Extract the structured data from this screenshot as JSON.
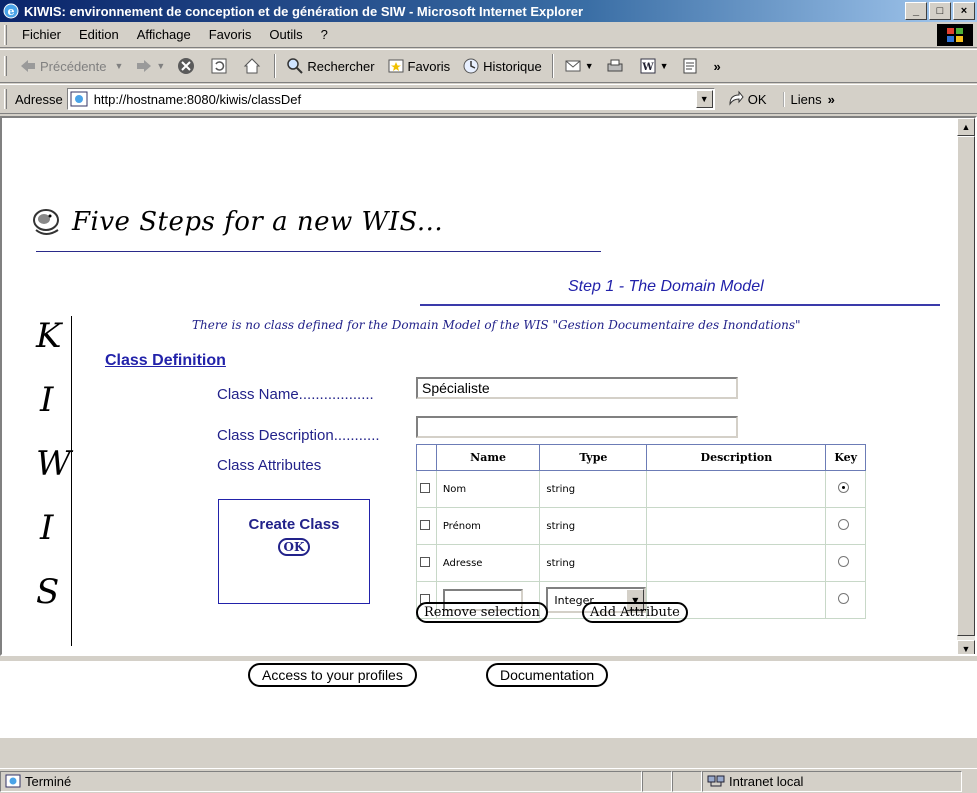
{
  "window": {
    "title": "KIWIS: environnement de conception et de génération de SIW - Microsoft Internet Explorer",
    "controls": [
      "_",
      "□",
      "×"
    ]
  },
  "menu": {
    "items": [
      "Fichier",
      "Edition",
      "Affichage",
      "Favoris",
      "Outils",
      "?"
    ]
  },
  "toolbar": {
    "back": "Précédente",
    "search": "Rechercher",
    "favorites": "Favoris",
    "history": "Historique"
  },
  "address": {
    "label": "Adresse",
    "url": "http://hostname:8080/kiwis/classDef",
    "go": "OK",
    "links": "Liens"
  },
  "page": {
    "headline": "Five Steps for a new WIS...",
    "step_title": "Step 1 - The Domain Model",
    "notice": "There is no class defined for the Domain Model of the WIS \"Gestion Documentaire des Inondations\"",
    "kiwis_letters": [
      "K",
      "I",
      "W",
      "I",
      "S"
    ],
    "class_definition": "Class Definition",
    "labels": {
      "class_name": "Class Name..................",
      "class_description": "Class Description...........",
      "class_attributes": "Class Attributes"
    },
    "class_name_value": "Spécialiste",
    "class_description_value": "",
    "table": {
      "headers": [
        "Name",
        "Type",
        "Description",
        "Key"
      ],
      "rows": [
        {
          "name": "Nom",
          "type": "string",
          "description": "",
          "key": true
        },
        {
          "name": "Prénom",
          "type": "string",
          "description": "",
          "key": false
        },
        {
          "name": "Adresse",
          "type": "string",
          "description": "",
          "key": false
        }
      ],
      "new_row": {
        "name": "",
        "type": "Integer",
        "description": "",
        "key": false
      }
    },
    "create_class_label": "Create Class",
    "ok_label": "OK",
    "remove_selection": "Remove selection",
    "add_attribute": "Add Attribute"
  },
  "footer": {
    "profiles": "Access to your profiles",
    "documentation": "Documentation"
  },
  "status": {
    "text": "Terminé",
    "zone": "Intranet local"
  },
  "colors": {
    "accent": "#22228a",
    "title_bar": "#0a246a"
  }
}
